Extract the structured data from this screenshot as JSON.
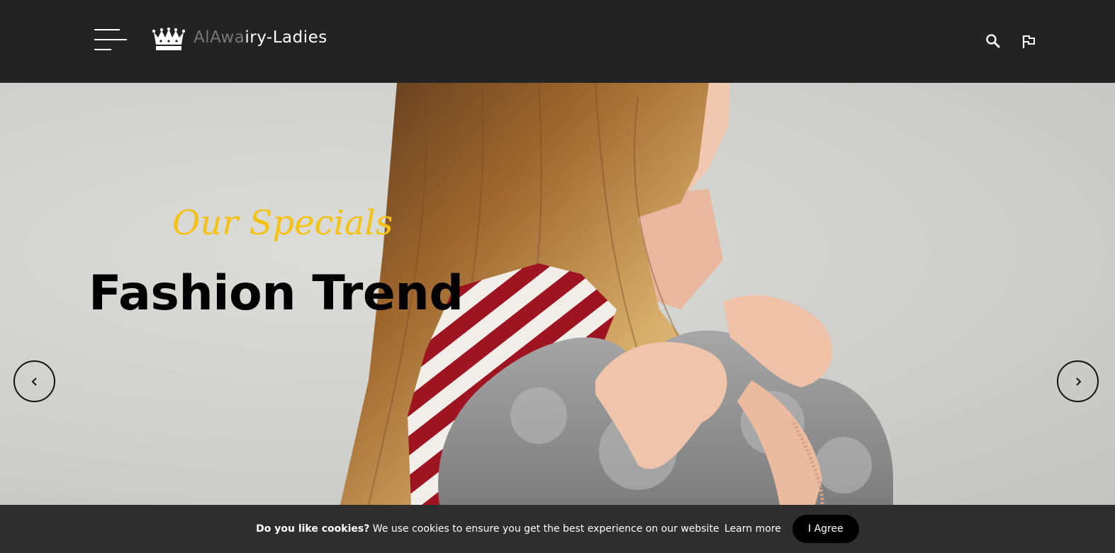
{
  "header": {
    "logo_text_dim": "AlAwa",
    "logo_text_main": "iry-Ladies",
    "menu_icon": "hamburger-icon",
    "search_icon": "search-icon",
    "language_icon": "flag-icon",
    "background": "#232323"
  },
  "hero": {
    "subtitle": "Our Specials",
    "title": "Fashion Trend",
    "subtitle_color": "#f5c211",
    "title_color": "#000000",
    "prev_icon": "chevron-left-icon",
    "next_icon": "chevron-right-icon"
  },
  "cookie_bar": {
    "question": "Do you like cookies?",
    "message": " We use cookies to ensure you get the best experience on our website",
    "learn_more": "Learn more",
    "agree_label": "I Agree",
    "background": "#2e2e2e"
  }
}
